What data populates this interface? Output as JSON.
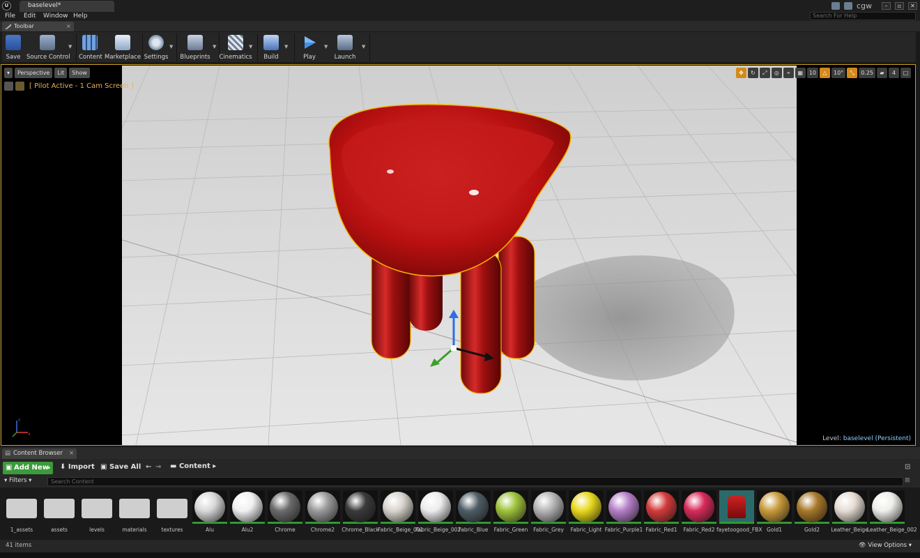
{
  "window": {
    "doc_tab": "baselevel*",
    "user": "cgw",
    "search_help_placeholder": "Search For Help"
  },
  "menu": [
    "File",
    "Edit",
    "Window",
    "Help"
  ],
  "toolbar": {
    "tab_label": "Toolbar",
    "buttons": {
      "save": "Save",
      "source_control": "Source Control",
      "content": "Content",
      "marketplace": "Marketplace",
      "settings": "Settings",
      "blueprints": "Blueprints",
      "cinematics": "Cinematics",
      "build": "Build",
      "play": "Play",
      "launch": "Launch"
    }
  },
  "viewport": {
    "perspective": "Perspective",
    "lit": "Lit",
    "show": "Show",
    "pilot_text": "[ Pilot Active - 1 Cam Screen ]",
    "grid_snap": "10",
    "rot_snap": "10°",
    "scale_snap": "0.25",
    "camera_speed": "4",
    "level_prefix": "Level:",
    "level_name": "baselevel (Persistent)",
    "selection_color": "#f5b400"
  },
  "content_browser": {
    "tab_label": "Content Browser",
    "add_new": "Add New",
    "import": "Import",
    "save_all": "Save All",
    "path": "Content",
    "filters": "Filters",
    "search_placeholder": "Search Content",
    "items_count": "41 items",
    "view_options": "View Options",
    "assets": [
      {
        "name": "1_assets",
        "kind": "folder"
      },
      {
        "name": "assets",
        "kind": "folder"
      },
      {
        "name": "levels",
        "kind": "folder"
      },
      {
        "name": "materials",
        "kind": "folder"
      },
      {
        "name": "textures",
        "kind": "folder"
      },
      {
        "name": "Alu",
        "kind": "material",
        "color": "#d8d8d8"
      },
      {
        "name": "Alu2",
        "kind": "material",
        "color": "#f0f0f0"
      },
      {
        "name": "Chrome",
        "kind": "material",
        "color": "#6a6a6a"
      },
      {
        "name": "Chrome2",
        "kind": "material",
        "color": "#9a9a9a"
      },
      {
        "name": "Chrome_Black",
        "kind": "material",
        "color": "#3a3a3a"
      },
      {
        "name": "Fabric_Beige_001",
        "kind": "material",
        "color": "#d8d4cc"
      },
      {
        "name": "Fabric_Beige_002",
        "kind": "material",
        "color": "#ececec"
      },
      {
        "name": "Fabric_Blue",
        "kind": "material",
        "color": "#4e5d66"
      },
      {
        "name": "Fabric_Green",
        "kind": "material",
        "color": "#9ec23a"
      },
      {
        "name": "Fabric_Grey",
        "kind": "material",
        "color": "#b5b5b5"
      },
      {
        "name": "Fabric_Light",
        "kind": "material",
        "color": "#e8d81c"
      },
      {
        "name": "Fabric_Purple1",
        "kind": "material",
        "color": "#b57ec8"
      },
      {
        "name": "Fabric_Red1",
        "kind": "material",
        "color": "#d43a3a"
      },
      {
        "name": "Fabric_Red2",
        "kind": "material",
        "color": "#d82a5a"
      },
      {
        "name": "fayetoogood_FBX",
        "kind": "mesh",
        "color": "#cc2222"
      },
      {
        "name": "Gold1",
        "kind": "material",
        "color": "#c89a3a"
      },
      {
        "name": "Gold2",
        "kind": "material",
        "color": "#a8782a"
      },
      {
        "name": "Leather_Beige",
        "kind": "material",
        "color": "#e6dcd4"
      },
      {
        "name": "Leather_Beige_002",
        "kind": "material",
        "color": "#eeeeea"
      }
    ]
  }
}
